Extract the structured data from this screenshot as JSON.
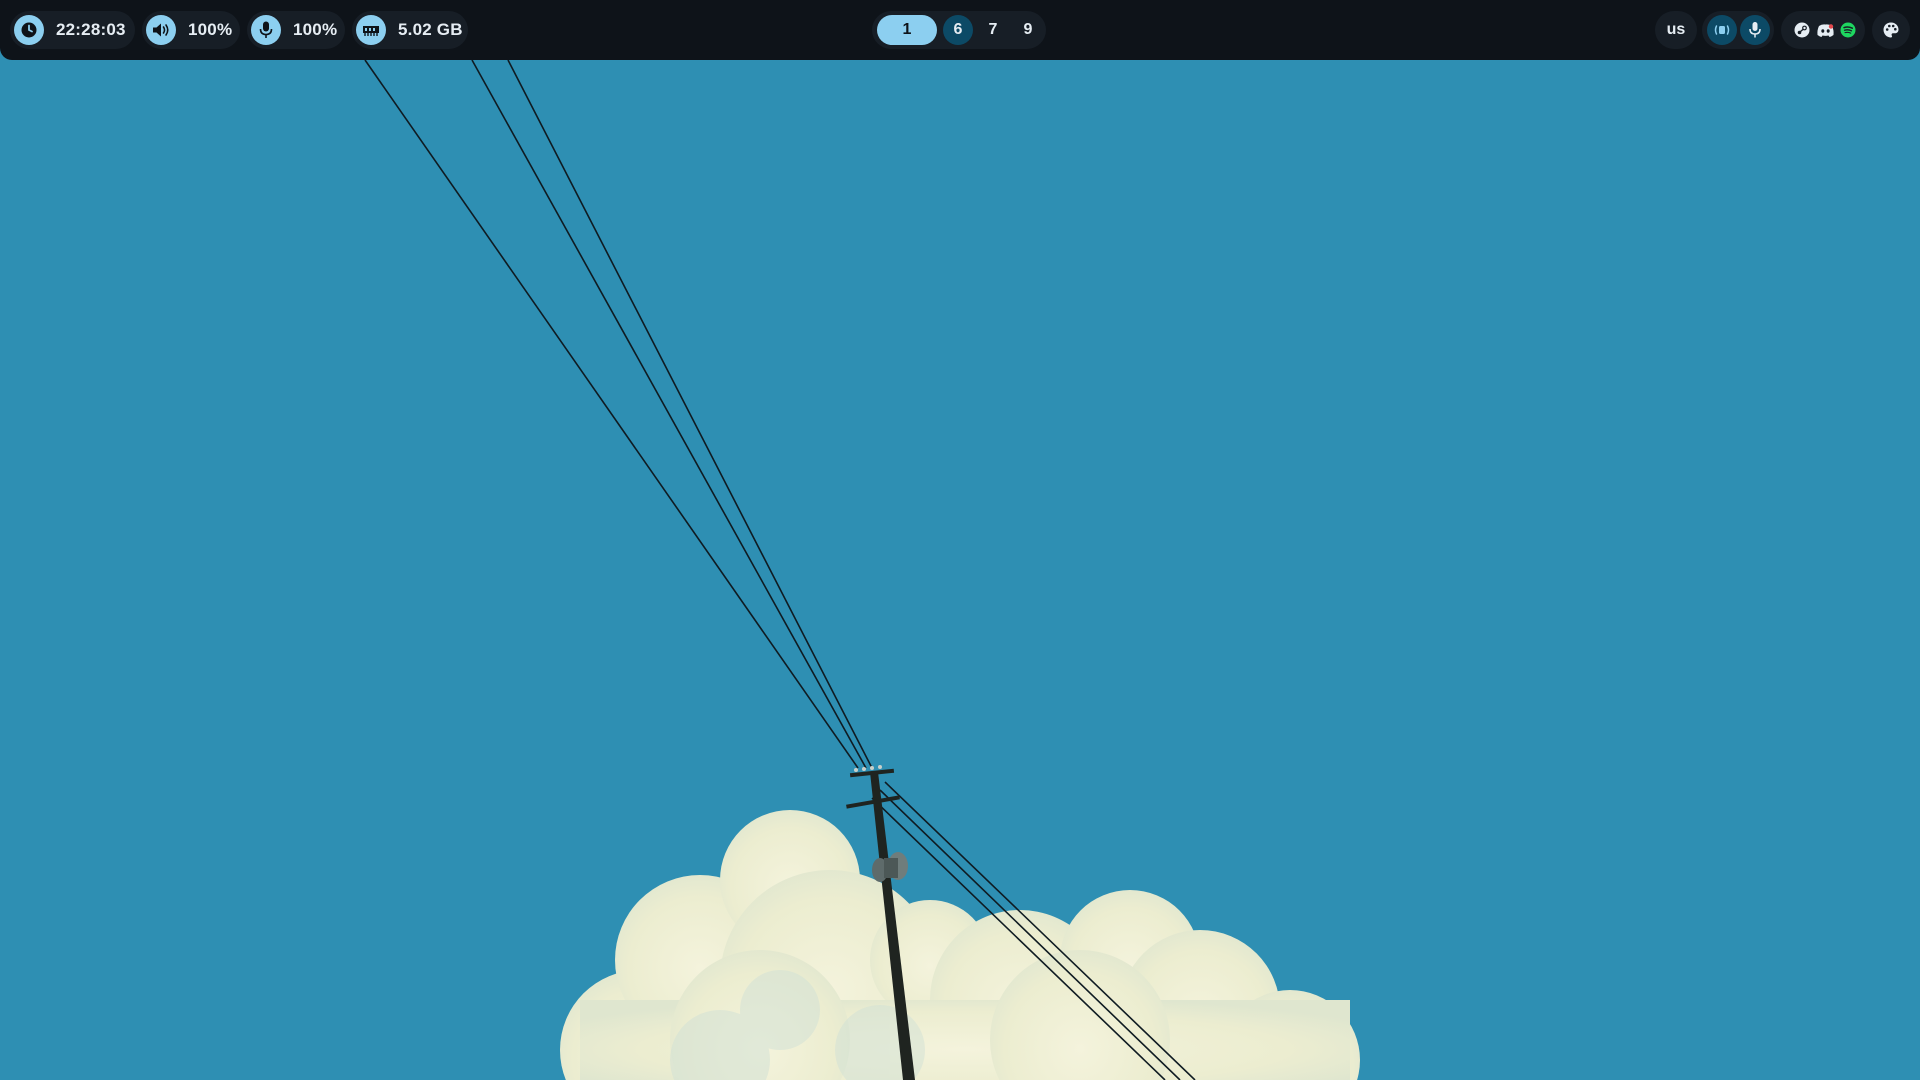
{
  "topbar": {
    "clock": {
      "icon": "clock-icon",
      "time": "22:28:03"
    },
    "volume": {
      "icon": "speaker-icon",
      "value": "100%"
    },
    "microphone": {
      "icon": "microphone-icon",
      "value": "100%"
    },
    "memory": {
      "icon": "memory-icon",
      "value": "5.02 GB"
    },
    "workspaces": [
      {
        "label": "1",
        "state": "active"
      },
      {
        "label": "6",
        "state": "occupied"
      },
      {
        "label": "7",
        "state": "empty"
      },
      {
        "label": "9",
        "state": "empty"
      }
    ],
    "keyboard_layout": "us",
    "privacy_indicators": [
      "screencast-icon",
      "microphone-in-use-icon"
    ],
    "tray": [
      "steam-icon",
      "discord-icon",
      "spotify-icon"
    ],
    "theme_button": {
      "icon": "palette-icon"
    }
  },
  "colors": {
    "bar_background": "#0e1319",
    "chip_background": "#171e26",
    "accent": "#8ccff0",
    "occupied_workspace": "#0c4a66",
    "sky": "#2e8fb3",
    "cloud": "#eef0d4",
    "spotify_green": "#1ed760"
  },
  "wallpaper": {
    "description_icon": "wallpaper-image"
  }
}
